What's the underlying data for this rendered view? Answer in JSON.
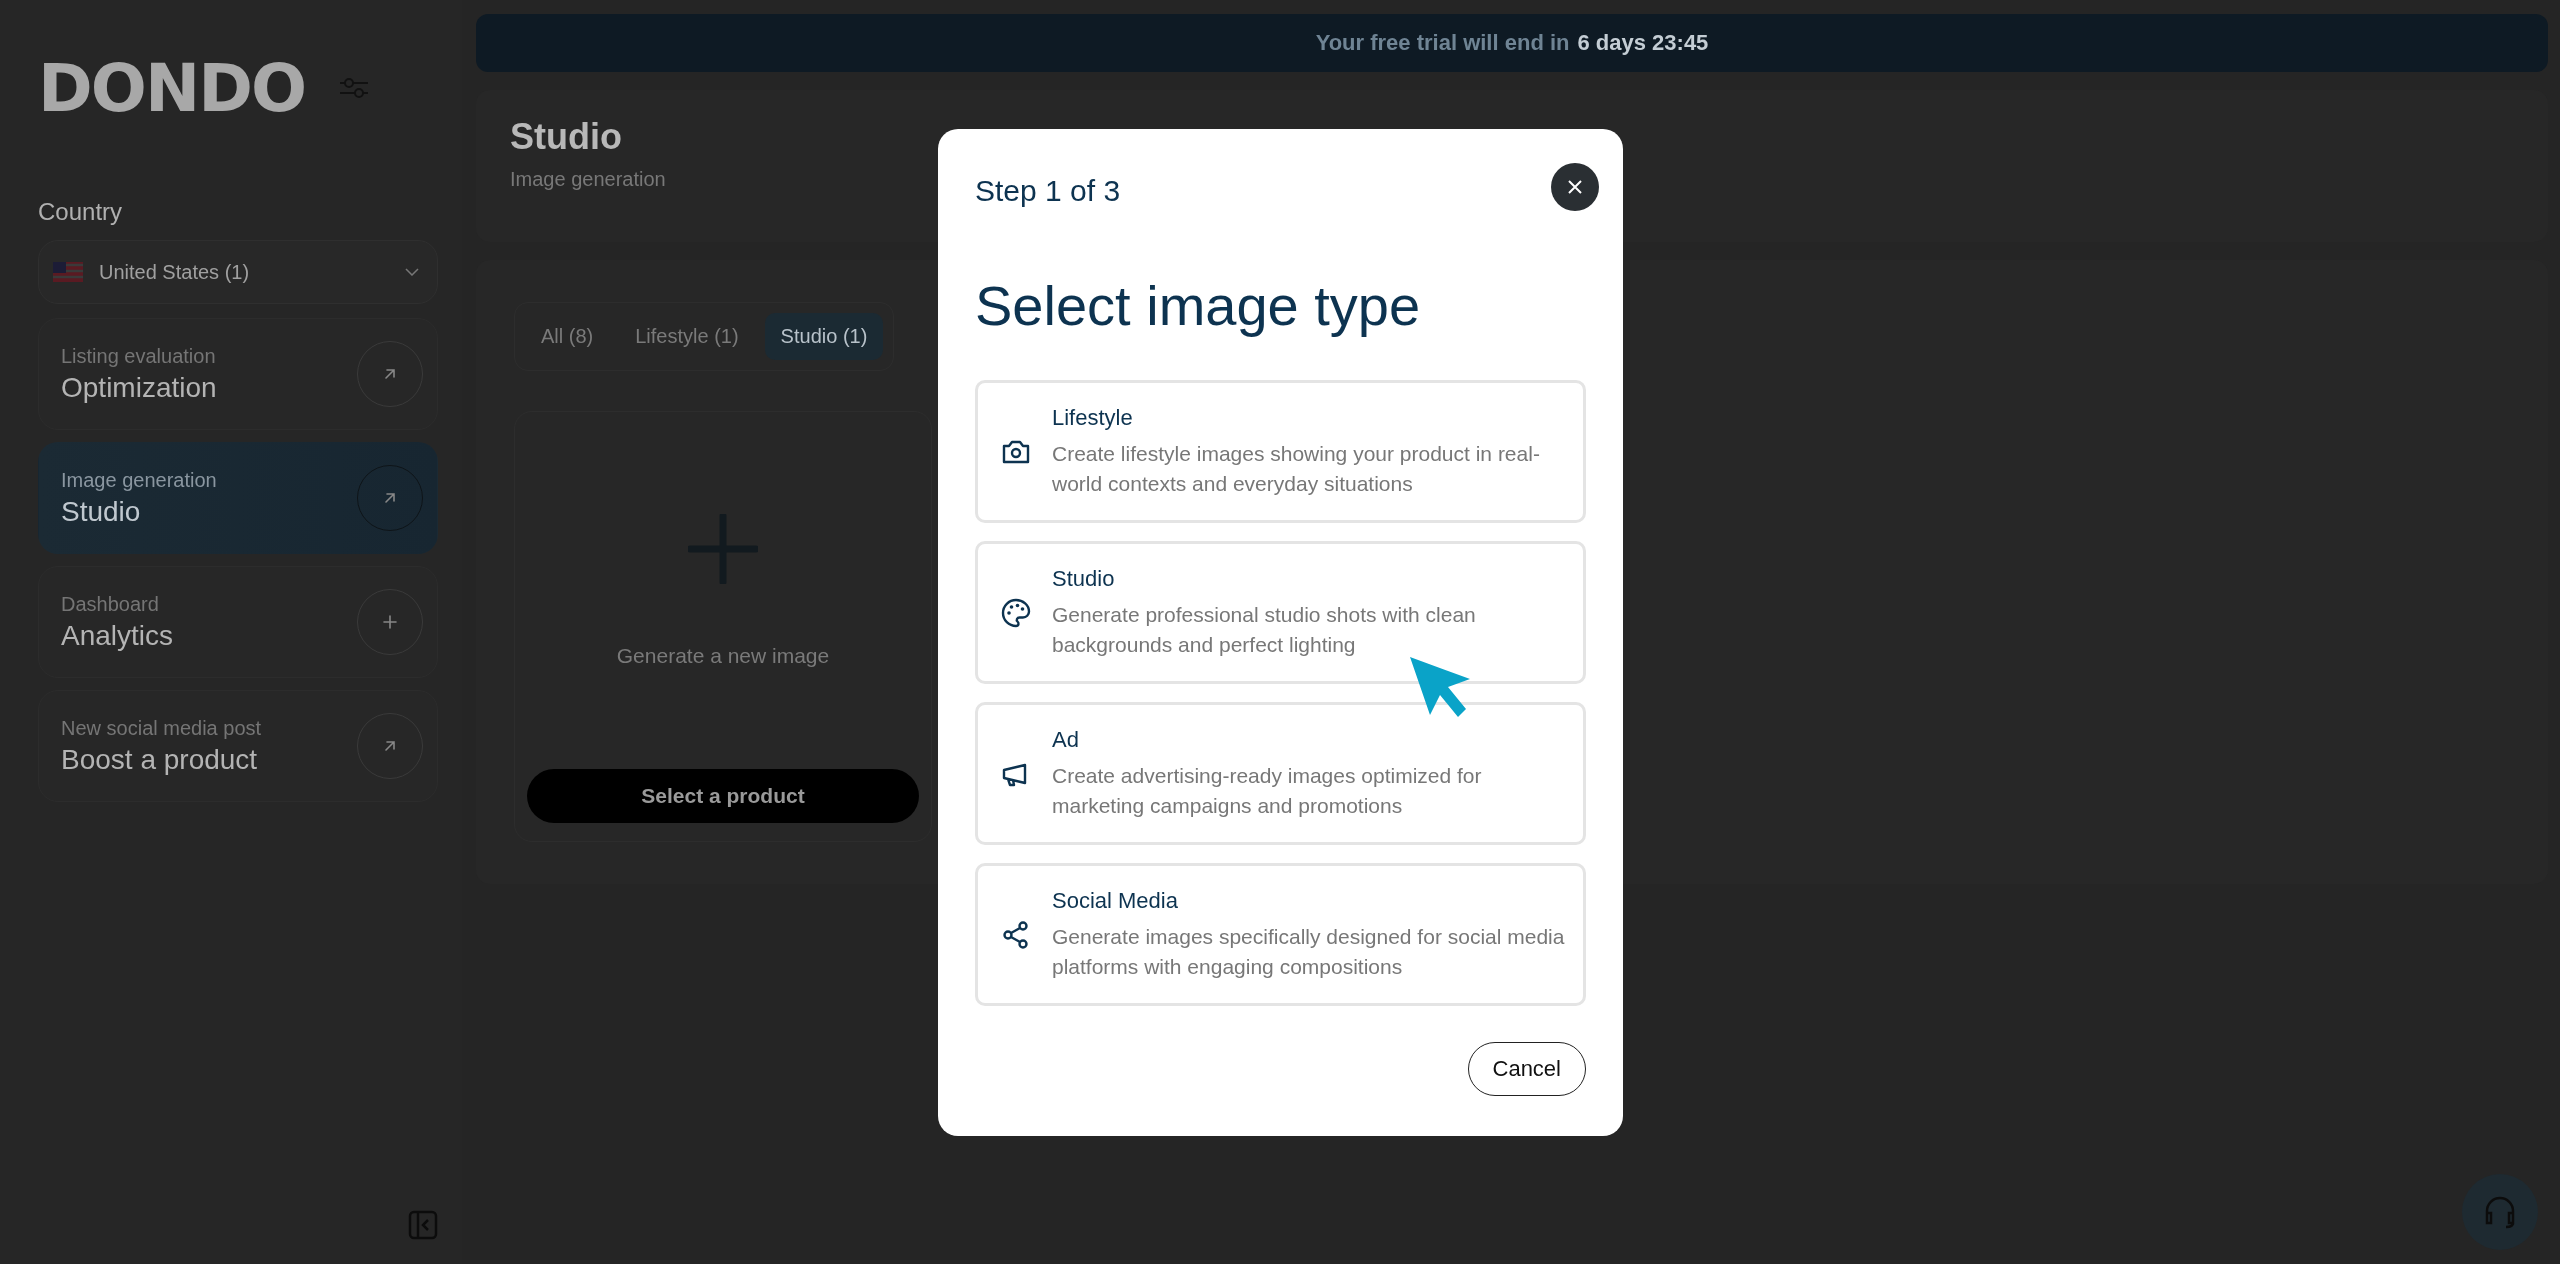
{
  "banner": {
    "text": "Your free trial will end in",
    "countdown": "6 days 23:45"
  },
  "sidebar": {
    "logo": "DONDO",
    "country_label": "Country",
    "country": "United States (1)",
    "items": [
      {
        "subtitle": "Listing evaluation",
        "title": "Optimization",
        "selected": false
      },
      {
        "subtitle": "Image generation",
        "title": "Studio",
        "selected": true
      },
      {
        "subtitle": "Dashboard",
        "title": "Analytics",
        "selected": false
      },
      {
        "subtitle": "New social media post",
        "title": "Boost a product",
        "selected": false
      }
    ]
  },
  "header": {
    "title": "Studio",
    "subtitle": "Image generation"
  },
  "tabs": [
    {
      "label": "All (8)",
      "selected": false
    },
    {
      "label": "Lifestyle (1)",
      "selected": false
    },
    {
      "label": "Studio (1)",
      "selected": true
    }
  ],
  "new_image_card": {
    "caption": "Generate a new image",
    "button": "Select a product"
  },
  "dialog": {
    "step": "Step 1 of 3",
    "title": "Select image type",
    "options": [
      {
        "title": "Lifestyle",
        "description": "Create lifestyle images showing your product in real-world contexts and everyday situations"
      },
      {
        "title": "Studio",
        "description": "Generate professional studio shots with clean backgrounds and perfect lighting"
      },
      {
        "title": "Ad",
        "description": "Create advertising-ready images optimized for marketing campaigns and promotions"
      },
      {
        "title": "Social Media",
        "description": "Generate images specifically designed for social media platforms with engaging compositions"
      }
    ],
    "cancel": "Cancel"
  }
}
